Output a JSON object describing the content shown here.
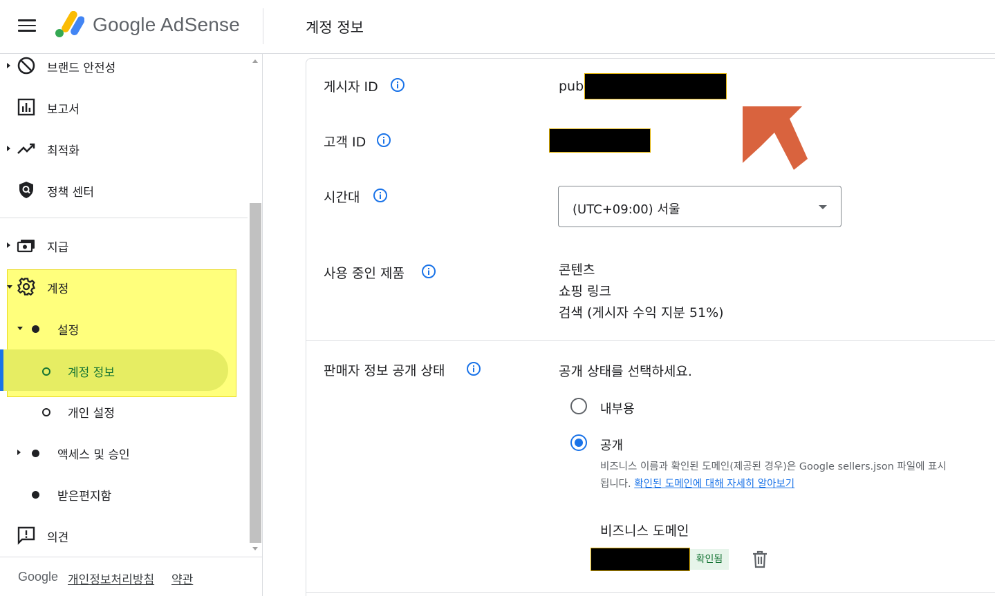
{
  "app": {
    "brand": "Google AdSense",
    "page_title": "계정 정보"
  },
  "sidebar": {
    "items": [
      {
        "label": "브랜드 안전성",
        "icon": "block-icon"
      },
      {
        "label": "보고서",
        "icon": "bar-chart-icon"
      },
      {
        "label": "최적화",
        "icon": "trending-up-icon"
      },
      {
        "label": "정책 센터",
        "icon": "shield-search-icon"
      },
      {
        "label": "지급",
        "icon": "payments-icon"
      },
      {
        "label": "계정",
        "icon": "gear-icon"
      },
      {
        "label": "설정"
      },
      {
        "label": "계정 정보"
      },
      {
        "label": "개인 설정"
      },
      {
        "label": "액세스 및 승인"
      },
      {
        "label": "받은편지함"
      },
      {
        "label": "의견",
        "icon": "feedback-icon"
      }
    ],
    "footer": {
      "google": "Google",
      "privacy": "개인정보처리방침",
      "terms": "약관"
    }
  },
  "account": {
    "publisher_id_label": "게시자 ID",
    "publisher_id_prefix": "pub-",
    "customer_id_label": "고객 ID",
    "timezone_label": "시간대",
    "timezone_value": "(UTC+09:00) 서울",
    "products_label": "사용 중인 제품",
    "products": [
      "콘텐츠",
      "쇼핑 링크",
      "검색 (게시자 수익 지분 51%)"
    ],
    "seller_label": "판매자 정보 공개 상태",
    "seller_prompt": "공개 상태를 선택하세요.",
    "option_internal": "내부용",
    "option_public": "공개",
    "selected_option": "공개",
    "public_desc": "비즈니스 이름과 확인된 도메인(제공된 경우)은 Google sellers.json 파일에 표시됩니다. ",
    "public_desc_link": "확인된 도메인에 대해 자세히 알아보기",
    "business_domain_label": "비즈니스 도메인",
    "verified_badge": "확인됨"
  },
  "colors": {
    "accent": "#1a73e8",
    "highlight": "#ffff66",
    "active_pill": "#e6ed63",
    "annotation_arrow": "#d9633e",
    "verified_green": "#137333"
  }
}
